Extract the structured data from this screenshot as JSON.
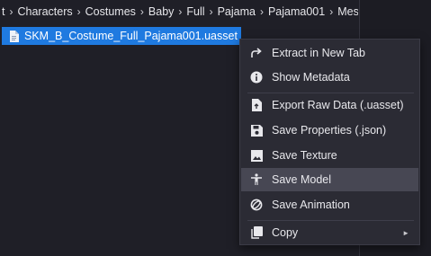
{
  "breadcrumb": {
    "items": [
      "t",
      "Characters",
      "Costumes",
      "Baby",
      "Full",
      "Pajama",
      "Pajama001",
      "Mesh"
    ]
  },
  "file": {
    "name": "SKM_B_Costume_Full_Pajama001.uasset",
    "icon": "file-icon"
  },
  "context_menu": {
    "items": [
      {
        "label": "Extract in New Tab",
        "icon": "share-arrow-icon"
      },
      {
        "label": "Show Metadata",
        "icon": "info-icon"
      },
      {
        "label": "Export Raw Data (.uasset)",
        "icon": "export-file-icon"
      },
      {
        "label": "Save Properties (.json)",
        "icon": "save-icon"
      },
      {
        "label": "Save Texture",
        "icon": "image-icon"
      },
      {
        "label": "Save Model",
        "icon": "person-icon",
        "highlighted": true
      },
      {
        "label": "Save Animation",
        "icon": "animation-ring-icon"
      },
      {
        "label": "Copy",
        "icon": "copy-icon",
        "has_submenu": true
      }
    ]
  },
  "colors": {
    "selection": "#1f7ae0",
    "menu_background": "#2b2b34",
    "menu_highlight": "#474753"
  }
}
